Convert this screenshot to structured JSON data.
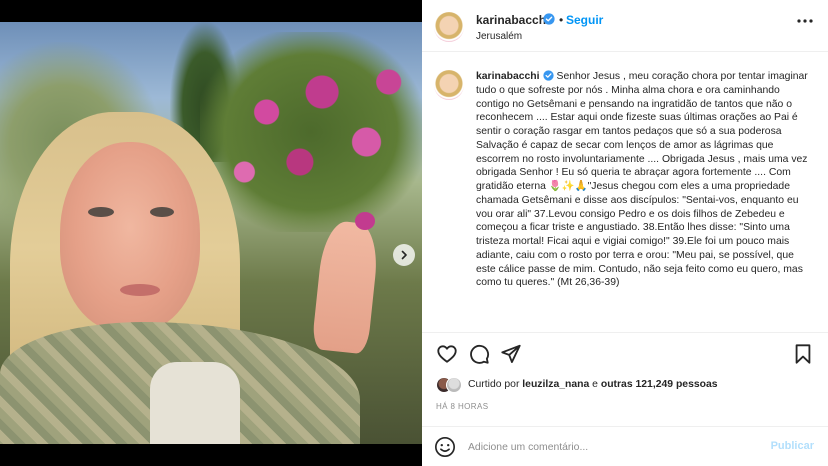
{
  "post": {
    "author": "karinabacchi",
    "follow_separator": "•",
    "follow_label": "Seguir",
    "location": "Jerusalém",
    "caption_author": "karinabacchi",
    "caption_text": "Senhor Jesus , meu coração chora por tentar imaginar tudo o que sofreste por nós . Minha alma chora e ora caminhando contigo no Getsêmani e pensando na ingratidão de tantos que não o reconhecem .... Estar aqui onde fizeste suas últimas orações ao Pai é sentir o coração rasgar em tantos pedaços que só a sua poderosa Salvação é capaz de secar com lenços de amor as lágrimas que escorrem no rosto involuntariamente .... Obrigada Jesus , mais uma vez obrigada Senhor ! Eu só queria te abraçar agora fortemente .... Com gratidão eterna 🌷✨🙏\"Jesus chegou com eles a uma propriedade chamada Getsêmani e disse aos discípulos: \"Sentai-vos, enquanto eu vou orar ali\" 37.Levou consigo Pedro e os dois filhos de Zebedeu e começou a ficar triste e angustiado. 38.Então lhes disse: \"Sinto uma tristeza mortal! Ficai aqui e vigiai comigo!\" 39.Ele foi um pouco mais adiante, caiu com o rosto por terra e orou: \"Meu pai, se possível, que este cálice passe de mim. Contudo, não seja feito como eu quero, mas como tu queres.\" (Mt 26,36-39)",
    "likes_prefix": "Curtido por ",
    "likes_user": "leuzilza_nana",
    "likes_middle": " e ",
    "likes_others": "outras 121,249 pessoas",
    "timestamp": "HÁ 8 HORAS"
  },
  "comment": {
    "placeholder": "Adicione um comentário...",
    "post_label": "Publicar"
  },
  "icons": {
    "verified": "verified-badge-icon",
    "more": "more-options-icon",
    "close": "close-icon",
    "next": "chevron-right-icon",
    "like": "heart-icon",
    "comment": "comment-bubble-icon",
    "share": "paper-plane-icon",
    "save": "bookmark-icon",
    "emoji": "smiley-icon"
  },
  "colors": {
    "accent": "#0095f6",
    "verified": "#3897f0",
    "text": "#262626",
    "muted": "#8e8e8e",
    "post_disabled": "#b2dffc"
  }
}
